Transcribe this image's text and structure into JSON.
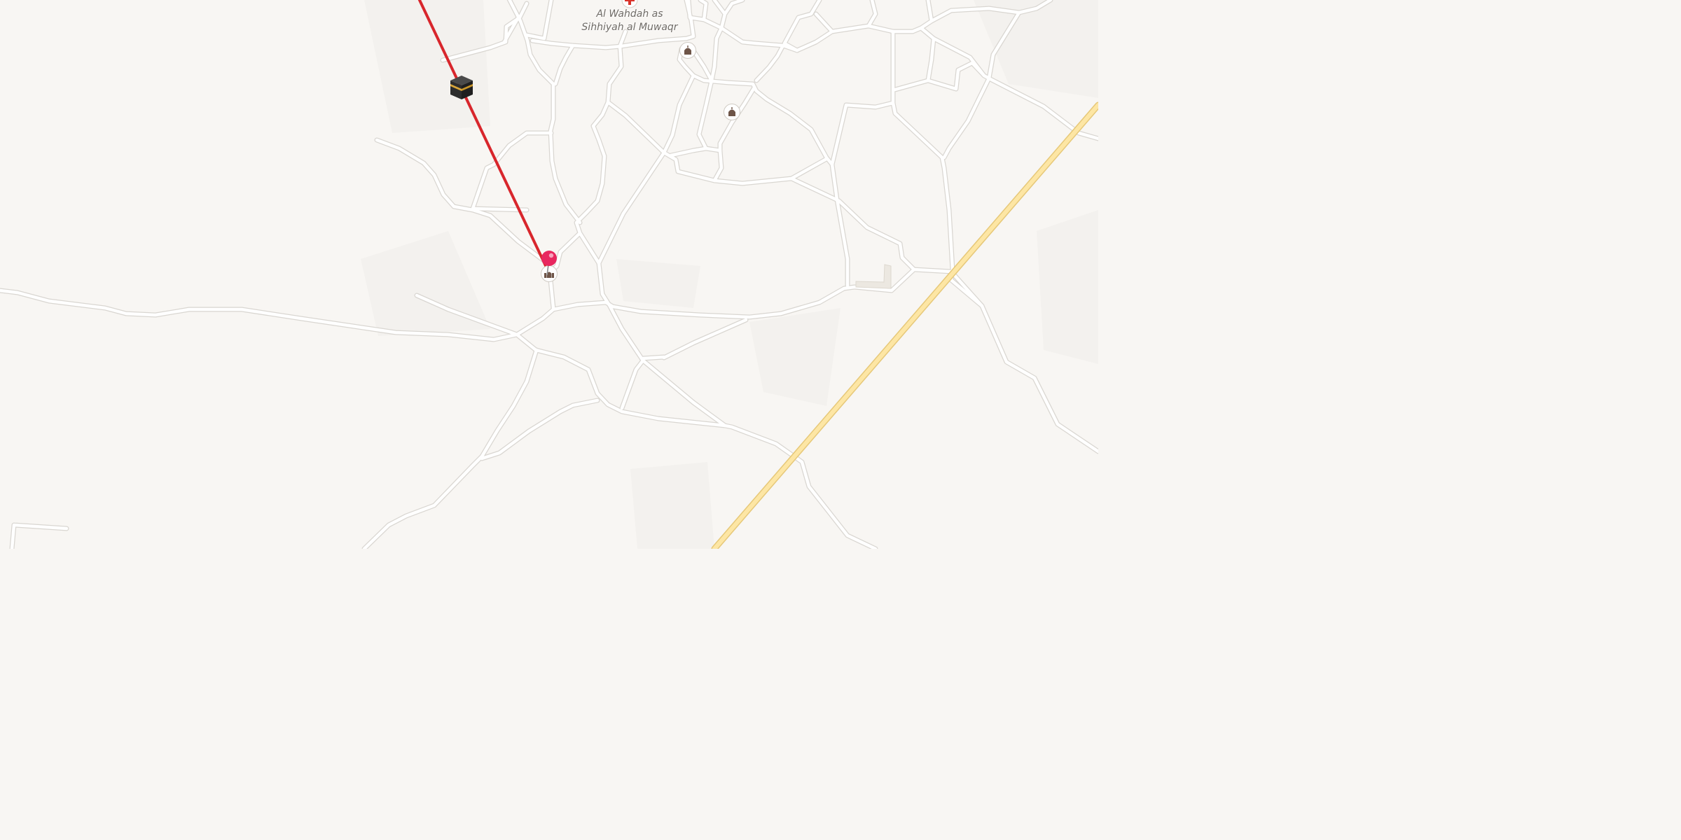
{
  "map": {
    "place_label_line1": "Al Wahdah as",
    "place_label_line2": "Sihhiyah al Muwaqr",
    "route_color": "#d8262c",
    "highway_color": "#fde6a4",
    "background_color": "#f8f6f3",
    "icons": {
      "hospital": "hospital-icon",
      "mosque": "mosque-icon",
      "kaaba": "kaaba-icon",
      "pin": "location-pin-icon"
    }
  }
}
